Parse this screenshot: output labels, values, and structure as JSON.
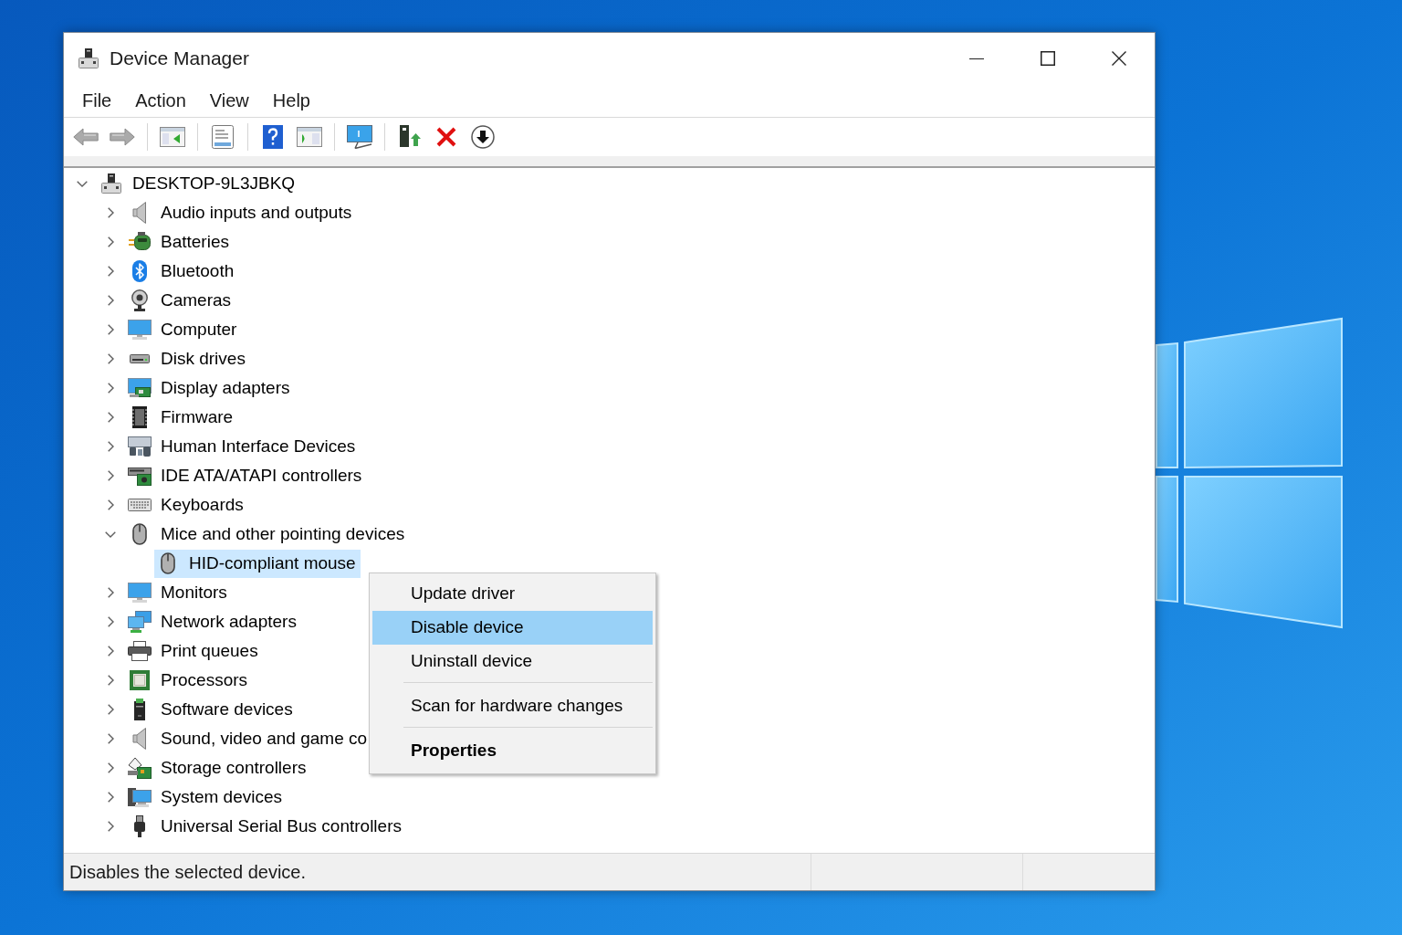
{
  "window": {
    "title": "Device Manager"
  },
  "menu_bar": [
    "File",
    "Action",
    "View",
    "Help"
  ],
  "tree": {
    "label": "DESKTOP-9L3JBKQ",
    "expanded": true,
    "selected": false,
    "children": [
      {
        "label": "Audio inputs and outputs",
        "expanded": false,
        "selected": false
      },
      {
        "label": "Batteries",
        "expanded": false,
        "selected": false
      },
      {
        "label": "Bluetooth",
        "expanded": false,
        "selected": false
      },
      {
        "label": "Cameras",
        "expanded": false,
        "selected": false
      },
      {
        "label": "Computer",
        "expanded": false,
        "selected": false
      },
      {
        "label": "Disk drives",
        "expanded": false,
        "selected": false
      },
      {
        "label": "Display adapters",
        "expanded": false,
        "selected": false
      },
      {
        "label": "Firmware",
        "expanded": false,
        "selected": false
      },
      {
        "label": "Human Interface Devices",
        "expanded": false,
        "selected": false
      },
      {
        "label": "IDE ATA/ATAPI controllers",
        "expanded": false,
        "selected": false
      },
      {
        "label": "Keyboards",
        "expanded": false,
        "selected": false
      },
      {
        "label": "Mice and other pointing devices",
        "expanded": true,
        "selected": false,
        "children": [
          {
            "label": "HID-compliant mouse",
            "selected": true
          }
        ]
      },
      {
        "label": "Monitors",
        "expanded": false,
        "selected": false
      },
      {
        "label": "Network adapters",
        "expanded": false,
        "selected": false
      },
      {
        "label": "Print queues",
        "expanded": false,
        "selected": false
      },
      {
        "label": "Processors",
        "expanded": false,
        "selected": false
      },
      {
        "label": "Software devices",
        "expanded": false,
        "selected": false
      },
      {
        "label": "Sound, video and game co",
        "expanded": false,
        "selected": false
      },
      {
        "label": "Storage controllers",
        "expanded": false,
        "selected": false
      },
      {
        "label": "System devices",
        "expanded": false,
        "selected": false
      },
      {
        "label": "Universal Serial Bus controllers",
        "expanded": false,
        "selected": false
      }
    ]
  },
  "context_menu": {
    "sections": [
      {
        "items": [
          {
            "label": "Update driver",
            "selected": false,
            "default": false
          },
          {
            "label": "Disable device",
            "selected": true,
            "default": false
          },
          {
            "label": "Uninstall device",
            "selected": false,
            "default": false
          }
        ]
      },
      {
        "items": [
          {
            "label": "Scan for hardware changes",
            "selected": false,
            "default": false
          }
        ]
      },
      {
        "items": [
          {
            "label": "Properties",
            "selected": false,
            "default": true
          }
        ]
      }
    ]
  },
  "status_bar": {
    "text": "Disables the selected device."
  }
}
